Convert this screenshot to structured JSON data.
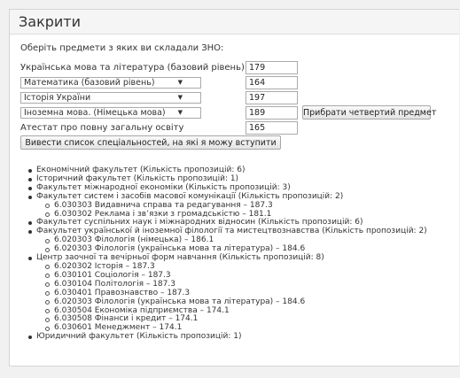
{
  "panel": {
    "title": "Закрити"
  },
  "form": {
    "instruction": "Оберіть предмети з яких ви складали ЗНО:",
    "fixed_subject_label": "Українська мова та література (базовий рівень)",
    "fixed_subject_score": "179",
    "subjects": [
      {
        "selected": "Математика (базовий рівень)",
        "score": "164"
      },
      {
        "selected": "Історія України",
        "score": "197"
      },
      {
        "selected": "Іноземна мова. (Німецька мова)",
        "score": "189"
      }
    ],
    "certificate_label": "Атестат про повну загальну освіту",
    "certificate_score": "165",
    "remove_fourth_button": "Прибрати четвертий предмет",
    "submit_button": "Вивести список спеціальностей, на які я можу вступити"
  },
  "icons": {
    "select_arrow": "▼"
  },
  "results": [
    {
      "text": "Економічний факультет (Кількість пропозицій: 6)",
      "specialties": []
    },
    {
      "text": "Історичний факультет (Кількість пропозицій: 1)",
      "specialties": []
    },
    {
      "text": "Факультет міжнародної економіки (Кількість пропозицій: 3)",
      "specialties": []
    },
    {
      "text": "Факультет систем і засобів масової комунікації (Кількість пропозицій: 2)",
      "specialties": [
        "6.030303 Видавнича справа та редагування – 187.3",
        "6.030302 Реклама і зв’язки з громадськістю – 181.1"
      ]
    },
    {
      "text": "Факультет суспільних наук і міжнародних відносин (Кількість пропозицій: 6)",
      "specialties": []
    },
    {
      "text": "Факультет української й іноземної філології та мистецтвознавства (Кількість пропозицій: 2)",
      "specialties": [
        "6.020303 Філологія (німецька) – 186.1",
        "6.020303 Філологія (українська мова та література) – 184.6"
      ]
    },
    {
      "text": "Центр заочної та вечірньої форм навчання (Кількість пропозицій: 8)",
      "specialties": [
        "6.020302 Історія – 187.3",
        "6.030101 Соціологія – 187.3",
        "6.030104 Політологія – 187.3",
        "6.030401 Правознавство – 187.3",
        "6.020303 Філологія (українська мова та література) – 184.6",
        "6.030504 Економіка підприємства – 174.1",
        "6.030508 Фінанси і кредит – 174.1",
        "6.030601 Менеджмент – 174.1"
      ]
    },
    {
      "text": "Юридичний факультет (Кількість пропозицій: 1)",
      "specialties": []
    }
  ]
}
